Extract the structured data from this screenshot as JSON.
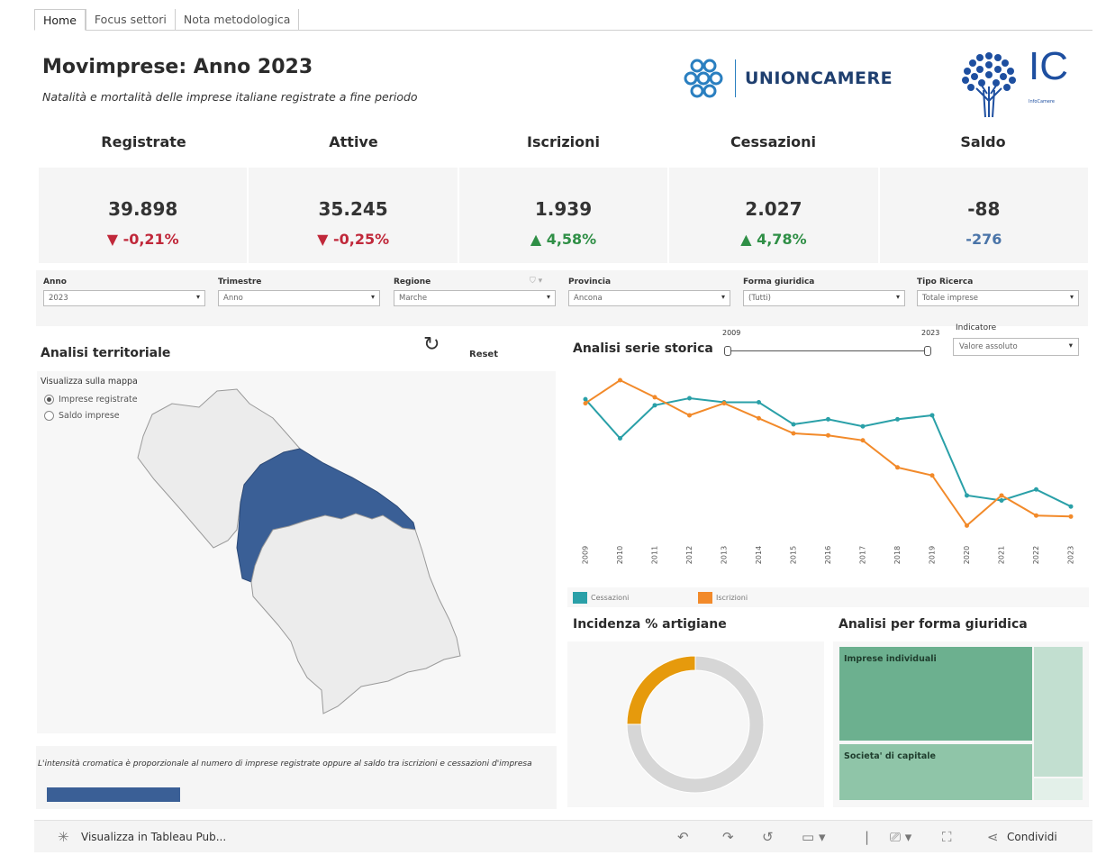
{
  "tabs": [
    "Home",
    "Focus settori",
    "Nota metodologica"
  ],
  "header": {
    "title": "Movimprese: Anno 2023",
    "subtitle": "Natalità e mortalità delle imprese italiane registrate a fine periodo",
    "logo_unioncamere": "UNIONCAMERE",
    "logo_ic": "IC",
    "logo_ic_small": "InfoCamere"
  },
  "kpis": [
    {
      "label": "Registrate",
      "value": "39.898",
      "change": "▼ -0,21%",
      "dir": "down"
    },
    {
      "label": "Attive",
      "value": "35.245",
      "change": "▼ -0,25%",
      "dir": "down"
    },
    {
      "label": "Iscrizioni",
      "value": "1.939",
      "change": "▲ 4,58%",
      "dir": "up"
    },
    {
      "label": "Cessazioni",
      "value": "2.027",
      "change": "▲ 4,78%",
      "dir": "up"
    },
    {
      "label": "Saldo",
      "value": "-88",
      "change": "-276",
      "dir": "blue"
    }
  ],
  "filters": [
    {
      "label": "Anno",
      "value": "2023"
    },
    {
      "label": "Trimestre",
      "value": "Anno"
    },
    {
      "label": "Regione",
      "value": "Marche"
    },
    {
      "label": "Provincia",
      "value": "Ancona"
    },
    {
      "label": "Forma giuridica",
      "value": "(Tutti)"
    },
    {
      "label": "Tipo Ricerca",
      "value": "Totale imprese"
    }
  ],
  "territorial": {
    "title": "Analisi territoriale",
    "reset_label": "Reset",
    "map_subtitle": "Visualizza sulla mappa",
    "radio_options": [
      "Imprese registrate",
      "Saldo imprese"
    ],
    "selected_option": 0,
    "note": "L'intensità cromatica è proporzionale al numero di imprese registrate oppure al saldo tra iscrizioni e cessazioni d'impresa",
    "legend_color": "#3a5f96",
    "highlight_color": "#3a5f96",
    "base_color": "#ececec"
  },
  "series": {
    "title": "Analisi serie storica",
    "slider_start": "2009",
    "slider_end": "2023",
    "indicator_label": "Indicatore",
    "indicator_value": "Valore assoluto"
  },
  "chart_data": {
    "type": "line",
    "x": [
      "2009",
      "2010",
      "2011",
      "2012",
      "2013",
      "2014",
      "2015",
      "2016",
      "2017",
      "2018",
      "2019",
      "2020",
      "2021",
      "2022",
      "2023"
    ],
    "series": [
      {
        "name": "Cessazioni",
        "color": "#2aa0a8",
        "values": [
          2920,
          2530,
          2860,
          2930,
          2890,
          2890,
          2670,
          2720,
          2650,
          2720,
          2760,
          1960,
          1910,
          2020,
          1850
        ]
      },
      {
        "name": "Iscrizioni",
        "color": "#f28a2a",
        "values": [
          2880,
          3110,
          2940,
          2760,
          2880,
          2730,
          2580,
          2560,
          2510,
          2240,
          2160,
          1660,
          1960,
          1760,
          1750
        ]
      }
    ],
    "ylim": [
      1600,
      3200
    ]
  },
  "donut": {
    "title": "Incidenza % artigiane",
    "artigiane_share": 0.25,
    "artigiane_color": "#e69a0c",
    "other_color": "#d6d6d6"
  },
  "treemap": {
    "title": "Analisi per forma giuridica",
    "items": [
      {
        "label": "Imprese individuali",
        "color": "#6cb08f"
      },
      {
        "label": "Societa' di capitale",
        "color": "#8fc5a8"
      },
      {
        "label": "",
        "color": "#c2dfd0"
      },
      {
        "label": "",
        "color": "#e3f0e9"
      }
    ]
  },
  "footer": {
    "tableau_label": "Visualizza in Tableau Pub...",
    "share_label": "Condividi"
  }
}
